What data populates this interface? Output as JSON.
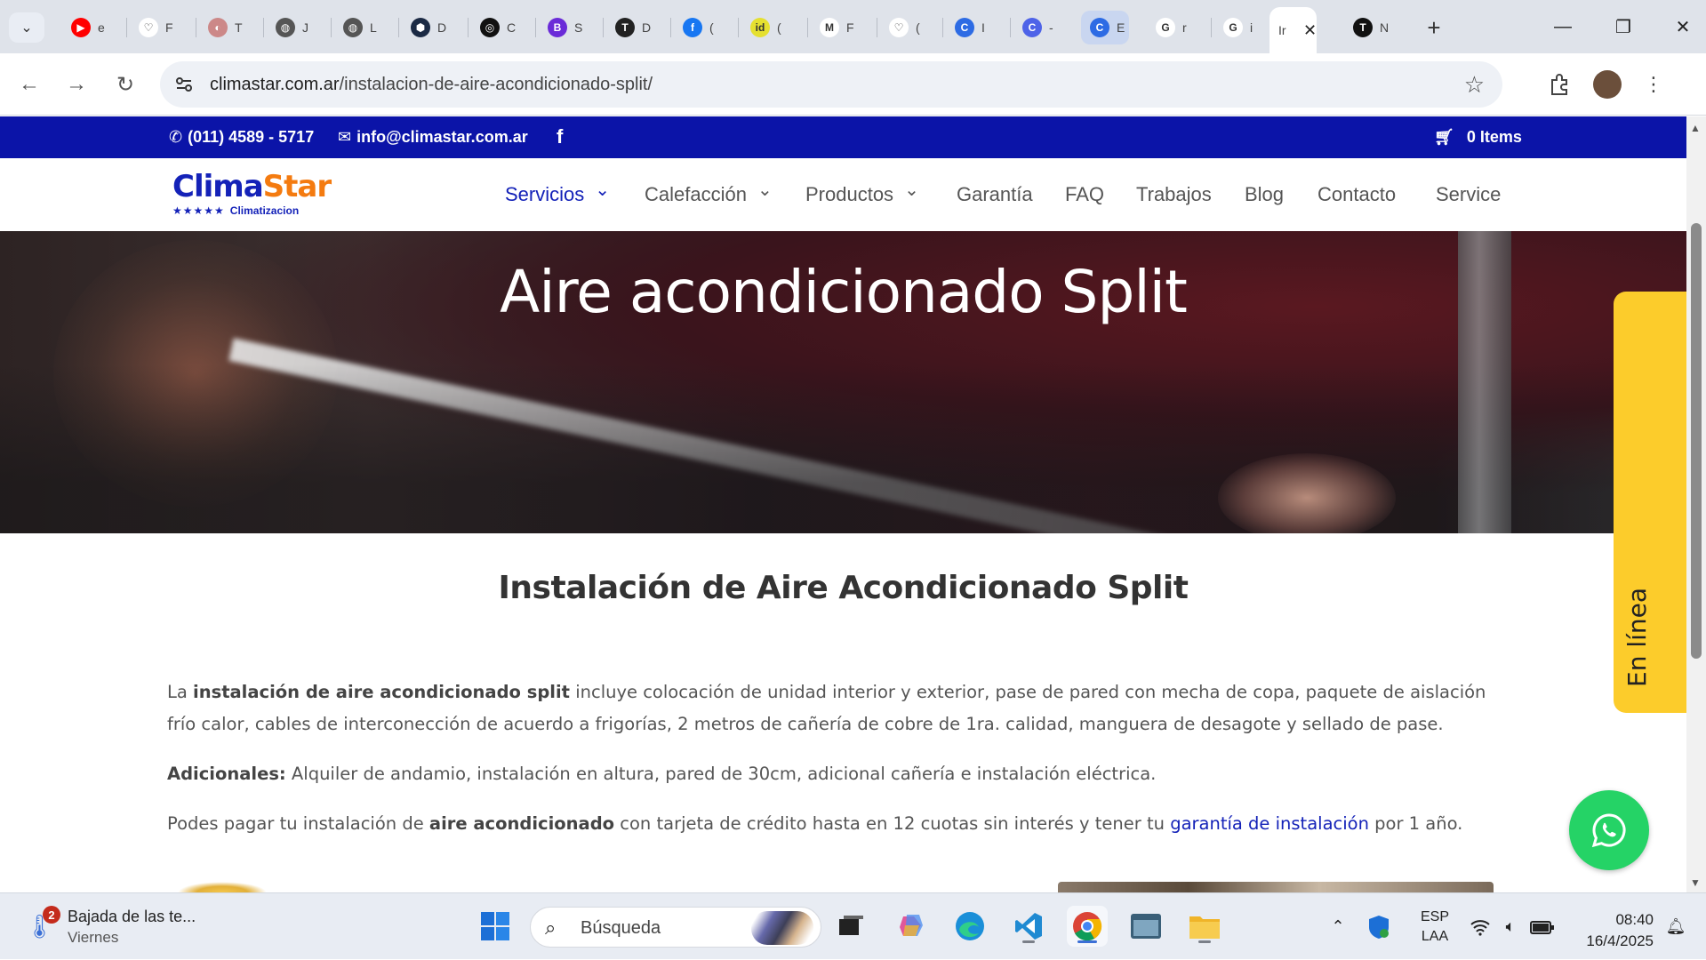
{
  "browser": {
    "tabs": [
      {
        "letter": "e",
        "fav_color": "#ff0000",
        "fav_glyph": "▶"
      },
      {
        "letter": "F",
        "fav_color": "#ffffff",
        "fav_glyph": "♡"
      },
      {
        "letter": "T",
        "fav_color": "#c88",
        "fav_glyph": "◐"
      },
      {
        "letter": "J",
        "fav_color": "#555",
        "fav_glyph": "◍"
      },
      {
        "letter": "L",
        "fav_color": "#555",
        "fav_glyph": "◍"
      },
      {
        "letter": "D",
        "fav_color": "#1b2a44",
        "fav_glyph": "⬢"
      },
      {
        "letter": "C",
        "fav_color": "#111",
        "fav_glyph": "◎"
      },
      {
        "letter": "S",
        "fav_color": "#6a2bd8",
        "fav_glyph": "B"
      },
      {
        "letter": "D",
        "fav_color": "#222",
        "fav_glyph": "T"
      },
      {
        "letter": "(",
        "fav_color": "#1877f2",
        "fav_glyph": "f"
      },
      {
        "letter": "(",
        "fav_color": "#e5e030",
        "fav_glyph": "id"
      },
      {
        "letter": "F",
        "fav_color": "#ffffff",
        "fav_glyph": "M"
      },
      {
        "letter": "(",
        "fav_color": "#ffffff",
        "fav_glyph": "♡"
      },
      {
        "letter": "I",
        "fav_color": "#2d6be4",
        "fav_glyph": "C"
      },
      {
        "letter": "-",
        "fav_color": "#4e63e8",
        "fav_glyph": "C"
      },
      {
        "letter": "E",
        "fav_color": "#2d6be4",
        "fav_glyph": "C"
      },
      {
        "letter": "r",
        "fav_color": "#ffffff",
        "fav_glyph": "G"
      },
      {
        "letter": "i",
        "fav_color": "#ffffff",
        "fav_glyph": "G"
      },
      {
        "letter": "Ir",
        "fav_color": "#ffffff",
        "fav_glyph": ""
      },
      {
        "letter": "N",
        "fav_color": "#111",
        "fav_glyph": "T"
      }
    ],
    "url_host": "climastar.com.ar",
    "url_path": "/instalacion-de-aire-acondicionado-split/"
  },
  "site": {
    "topbar": {
      "phone": "(011) 4589 - 5717",
      "email": "info@climastar.com.ar",
      "facebook": "f",
      "cart": "0 Items"
    },
    "logo": {
      "brand_a": "Clima",
      "brand_b": "Star",
      "stars": "★★★★★",
      "tagline": "Climatizacion"
    },
    "menu": [
      "Servicios",
      "Calefacción",
      "Productos",
      "Garantía",
      "FAQ",
      "Trabajos",
      "Blog",
      "Contacto",
      "Service"
    ],
    "hero_title": "Aire acondicionado Split",
    "heading": "Instalación de Aire Acondicionado Split",
    "p1": {
      "a": "La ",
      "b": "instalación de aire acondicionado split",
      "c": " incluye colocación de unidad interior y exterior, pase de pared con mecha de copa, paquete de aislación frío calor, cables de interconección de acuerdo a frigorías, 2 metros de cañería de cobre de 1ra. calidad, manguera de desagote y sellado de pase."
    },
    "p2": {
      "b": "Adicionales:",
      "c": " Alquiler de andamio, instalación en altura, pared de 30cm, adicional cañería e instalación eléctrica."
    },
    "p3": {
      "a": "Podes pagar tu instalación de ",
      "b": "aire acondicionado",
      "c": " con tarjeta de crédito hasta en 12 cuotas sin interés y tener tu ",
      "link": "garantía de instalación",
      "d": " por 1 año."
    },
    "chat_tab": "En línea",
    "colors": {
      "topbar": "#0b14a8",
      "brand": "#1422b8",
      "accent": "#f47b10",
      "chat": "#fccc2b",
      "whatsapp": "#25d366"
    }
  },
  "taskbar": {
    "weather_title": "Bajada de las te...",
    "weather_day": "Viernes",
    "weather_badge": "2",
    "search_label": "Búsqueda",
    "lang_1": "ESP",
    "lang_2": "LAA",
    "time": "08:40",
    "date": "16/4/2025"
  }
}
